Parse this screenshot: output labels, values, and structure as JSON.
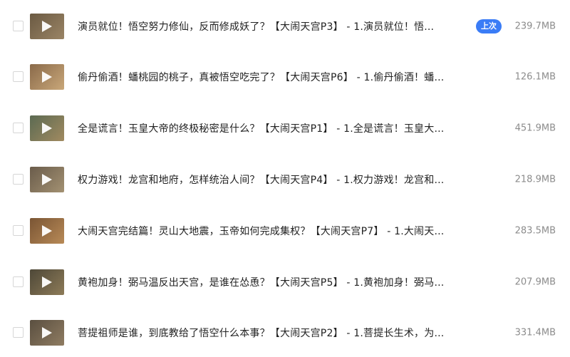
{
  "items": [
    {
      "title": "演员就位！悟空努力修仙，反而修成妖了？【大闹天宫P3】 - 1.演员就位！悟...",
      "badge": "上次",
      "size": "239.7MB",
      "thumb_colors": [
        "#6b5a43",
        "#9a8465"
      ]
    },
    {
      "title": "偷丹偷酒！蟠桃园的桃子，真被悟空吃完了？【大闹天宫P6】 - 1.偷丹偷酒！蟠...",
      "size": "126.1MB",
      "thumb_colors": [
        "#8a6a4a",
        "#c9a779"
      ]
    },
    {
      "title": "全是谎言！玉皇大帝的终极秘密是什么？【大闹天宫P1】 - 1.全是谎言！玉皇大...",
      "size": "451.9MB",
      "thumb_colors": [
        "#5b6a52",
        "#a18a60"
      ]
    },
    {
      "title": "权力游戏！龙宫和地府，怎样统治人间？【大闹天宫P4】 - 1.权力游戏！龙宫和...",
      "size": "218.9MB",
      "thumb_colors": [
        "#6a5c4b",
        "#a39172"
      ]
    },
    {
      "title": "大闹天宫完结篇！灵山大地震，玉帝如何完成集权？【大闹天宫P7】 - 1.大闹天...",
      "size": "283.5MB",
      "thumb_colors": [
        "#7a5534",
        "#b88a57"
      ]
    },
    {
      "title": "黄袍加身！弼马温反出天宫，是谁在怂恿？【大闹天宫P5】 - 1.黄袍加身！弼马...",
      "size": "207.9MB",
      "thumb_colors": [
        "#4e4838",
        "#8d7b58"
      ]
    },
    {
      "title": "菩提祖师是谁，到底教给了悟空什么本事？【大闹天宫P2】 - 1.菩提长生术，为...",
      "size": "331.4MB",
      "thumb_colors": [
        "#5a4f40",
        "#8f7c62"
      ]
    }
  ]
}
